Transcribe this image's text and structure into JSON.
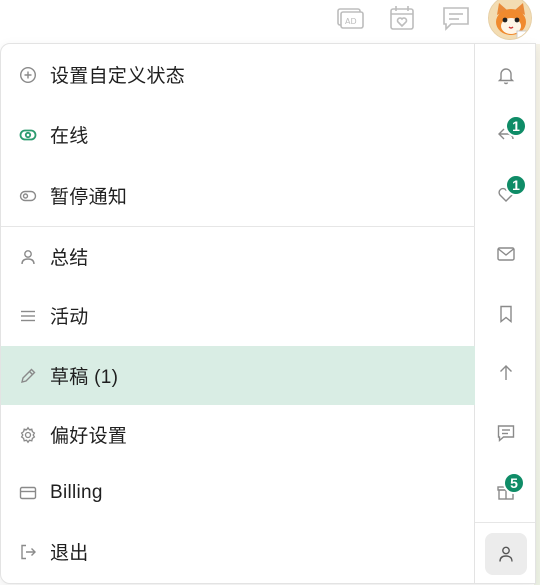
{
  "header": {
    "icons": [
      "ad-icon",
      "calendar-heart-icon",
      "chat-icon"
    ],
    "avatar": "avatar"
  },
  "menu": {
    "items": [
      {
        "label": "设置自定义状态",
        "icon": "plus-circle-icon"
      },
      {
        "label": "在线",
        "icon": "toggle-on-icon"
      },
      {
        "label": "暂停通知",
        "icon": "toggle-off-icon"
      },
      {
        "label": "总结",
        "icon": "user-icon"
      },
      {
        "label": "活动",
        "icon": "list-icon"
      },
      {
        "label": "草稿 (1)",
        "icon": "pencil-icon"
      },
      {
        "label": "偏好设置",
        "icon": "gear-icon"
      },
      {
        "label": "Billing",
        "icon": "card-icon"
      },
      {
        "label": "退出",
        "icon": "logout-icon"
      }
    ],
    "active_index": 5
  },
  "rail": {
    "icons": [
      "bell-icon",
      "reply-icon",
      "heart-icon",
      "mail-icon",
      "bookmark-icon",
      "arrow-up-icon",
      "message-icon",
      "gift-icon",
      "profile-icon"
    ],
    "badges": {
      "reply": "1",
      "heart": "1",
      "gift": "5"
    }
  },
  "colors": {
    "active_bg": "#d9ede4",
    "badge": "#0f8c67",
    "online": "#2c9b6f"
  }
}
